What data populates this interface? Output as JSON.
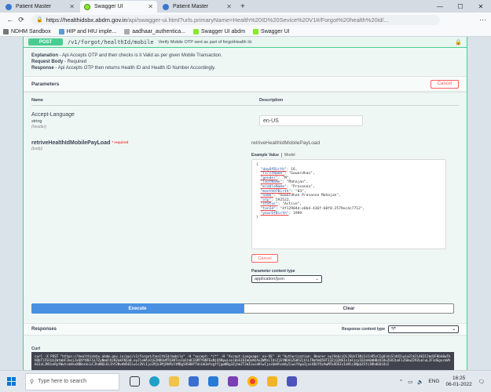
{
  "browser": {
    "tabs": [
      {
        "label": "Patient Master",
        "active": false
      },
      {
        "label": "Swagger UI",
        "active": true
      },
      {
        "label": "Patient Master",
        "active": false
      }
    ],
    "url_host": "https://healthidsbx.abdm.gov.in",
    "url_path": "/api/swagger-ui.html?urls.primaryName=Health%20ID%20Sevice%20V1#/Forgot%20health%20id/...",
    "bookmarks": [
      "NDHM Sandbox",
      "HIP and HIU imple...",
      "aadhaar_authentica...",
      "Swagger UI abdm",
      "Swagger UI"
    ]
  },
  "operation": {
    "method": "POST",
    "path": "/v1/forgot/healthId/mobile",
    "summary": "Verify Mobile OTP sent as part of forgotHealth Id.",
    "desc_explanation_label": "Explanation",
    "desc_explanation": " - Api Accepts OTP and then checks is it Valid as per given Mobile Transaction.",
    "desc_request_label": "Request Body",
    "desc_request": " - Required",
    "desc_response_label": "Response",
    "desc_response": " - Api Accepts OTP then returns Health ID and Health ID Number Accordingly."
  },
  "parameters": {
    "title": "Parameters",
    "cancel_label": "Cancel",
    "col_name": "Name",
    "col_desc": "Description",
    "accept_language": {
      "name": "Accept-Language",
      "type": "string",
      "in": "(header)",
      "value": "en-US"
    },
    "body": {
      "name": "retriveHealthIdMobilePayLoad",
      "required_mark": "* required",
      "in": "(body)",
      "desc": "retriveHealthIdMobilePayLoad"
    },
    "example_tab": "Example Value",
    "model_tab": "Model",
    "json_lines": [
      "{",
      "  \"dayOfBirth\": 16,",
      "  \"firstName\": \"Gowardhan\",",
      "  \"gender\": \"M\",",
      "  \"lastName\": \"Mahajan\",",
      "  \"middleName\": \"Prasanna\",",
      "  \"monthOfBirth\": \"03\",",
      "  \"name\": \"Gowardhan Prasanna Mahajan\",",
      "  \"otp\": 592522,",
      "  \"status\": \"Active\",",
      "  \"txnId\": \"4f12904d-e8bd-436f-60f8-2579ec4c7712\",",
      "  \"yearOfBirth\": 1999",
      "}"
    ],
    "cancel_label_2": "Cancel",
    "content_type_label": "Parameter content type",
    "content_type_value": "application/json"
  },
  "actions": {
    "execute": "Execute",
    "clear": "Clear"
  },
  "responses": {
    "title": "Responses",
    "content_type_label": "Response content type",
    "content_type_value": "*/*"
  },
  "curl": {
    "label": "Curl",
    "text": "curl -X POST \"https://healthidsbx.abdm.gov.in/api/v1/forgot/healthId/mobile\" -H \"accept: */*\" -H \"Accept-Language: en-US\" -H \"Authorization: Bearer eyJhbGciOiJSUzI1NiIsInR5cCIgOiAiSldUIiwia2lkIiA6ICJmd3FHbk8wTkhDbTlFSlUzZmtmbFJnejJvQXYtRElSLTZyNmdlVzRZakFNIn0.eyJleHAiOjE2NDUxMTQ3NTcsImlhdCI6MTY0NTExNjQ5Nywianl0aSI6ImQxNzAxZWMzLTdiZjEtNDA1ZS05ZjhlLTRmYmQ5OTI3ZjQ2NSIsImlzcyI6Imh0dHBzOi8vZGV2LmFiZG0uZ292LmluL2F1dGgvcmVhbG1zL2NlbnRyYWwtcmVnaXN0cnkiLCJhdWQiOiJhY2NvdW50Iiwic3ViIjoiMjk3MjRhMzItMDg5OS00YTdiLWJmYzgtYjgwNDg3ZjhmZTJmIiwidHlwIjoiQmVhcmVyIiwiYXpwIjoiU0JYXzAwMTk4OSIsInNlc3Npb25fc3RhdGUiOiI"
  },
  "taskbar": {
    "search_placeholder": "Type here to search",
    "language": "ENG",
    "time": "16:25",
    "date": "06-01-2022"
  },
  "colors": {
    "post": "#49cc90",
    "execute": "#4990e2",
    "cancel": "#ff6060"
  }
}
